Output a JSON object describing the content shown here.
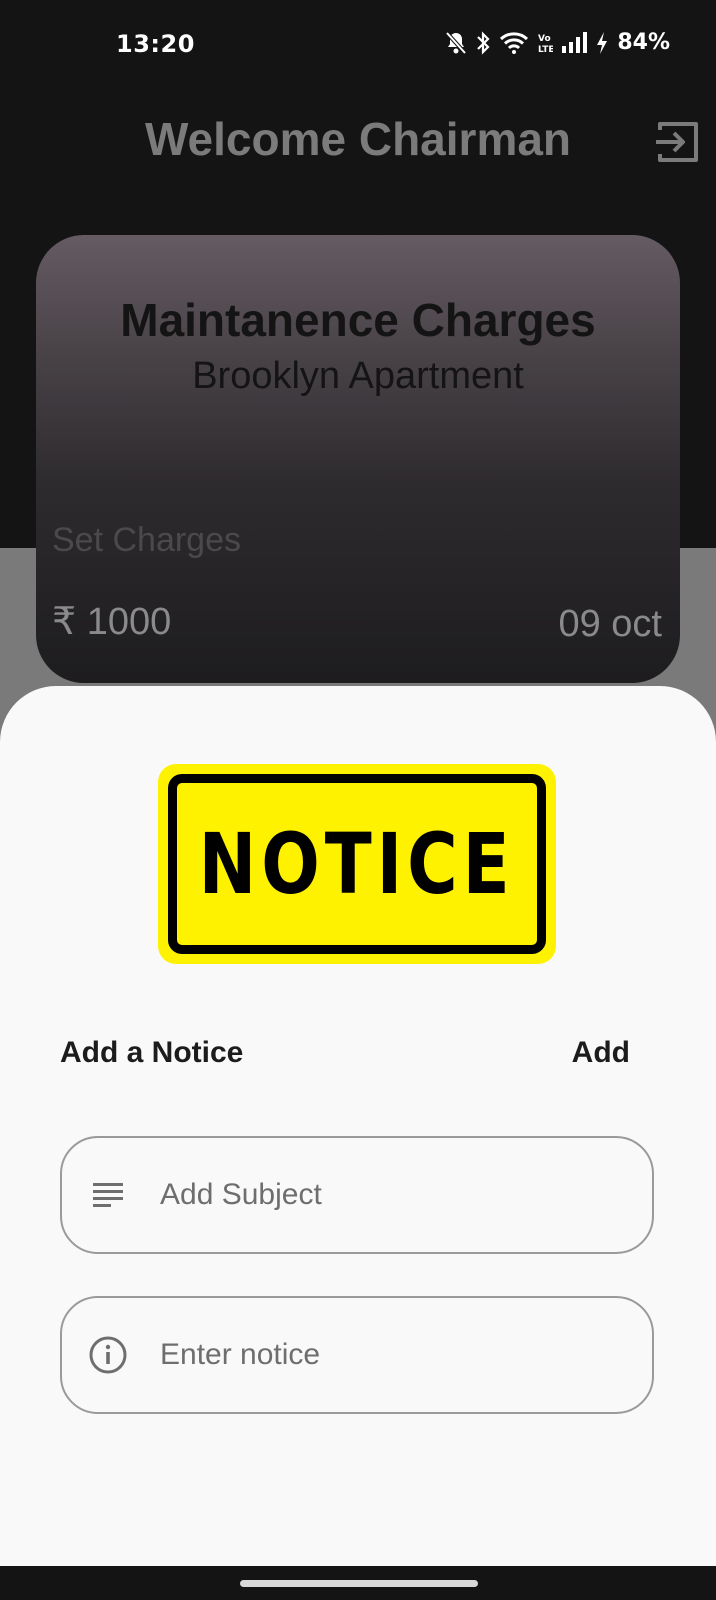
{
  "status_bar": {
    "time": "13:20",
    "battery": "84%",
    "icons": [
      "bell-off-icon",
      "bluetooth-icon",
      "wifi-icon",
      "volte-icon",
      "signal-icon",
      "charging-bolt-icon"
    ]
  },
  "header": {
    "title": "Welcome Chairman",
    "logout_icon": "logout-icon"
  },
  "card": {
    "title": "Maintanence Charges",
    "subtitle": "Brooklyn Apartment",
    "set_label": "Set Charges",
    "amount": "₹ 1000",
    "date": "09 oct"
  },
  "sheet": {
    "banner_text": "NOTICE",
    "label": "Add a Notice",
    "add_button": "Add",
    "subject_placeholder": "Add Subject",
    "notice_placeholder": "Enter notice"
  },
  "colors": {
    "banner_yellow": "#fff200",
    "background_dark": "#141414",
    "sheet_background": "#f9f9f9"
  }
}
